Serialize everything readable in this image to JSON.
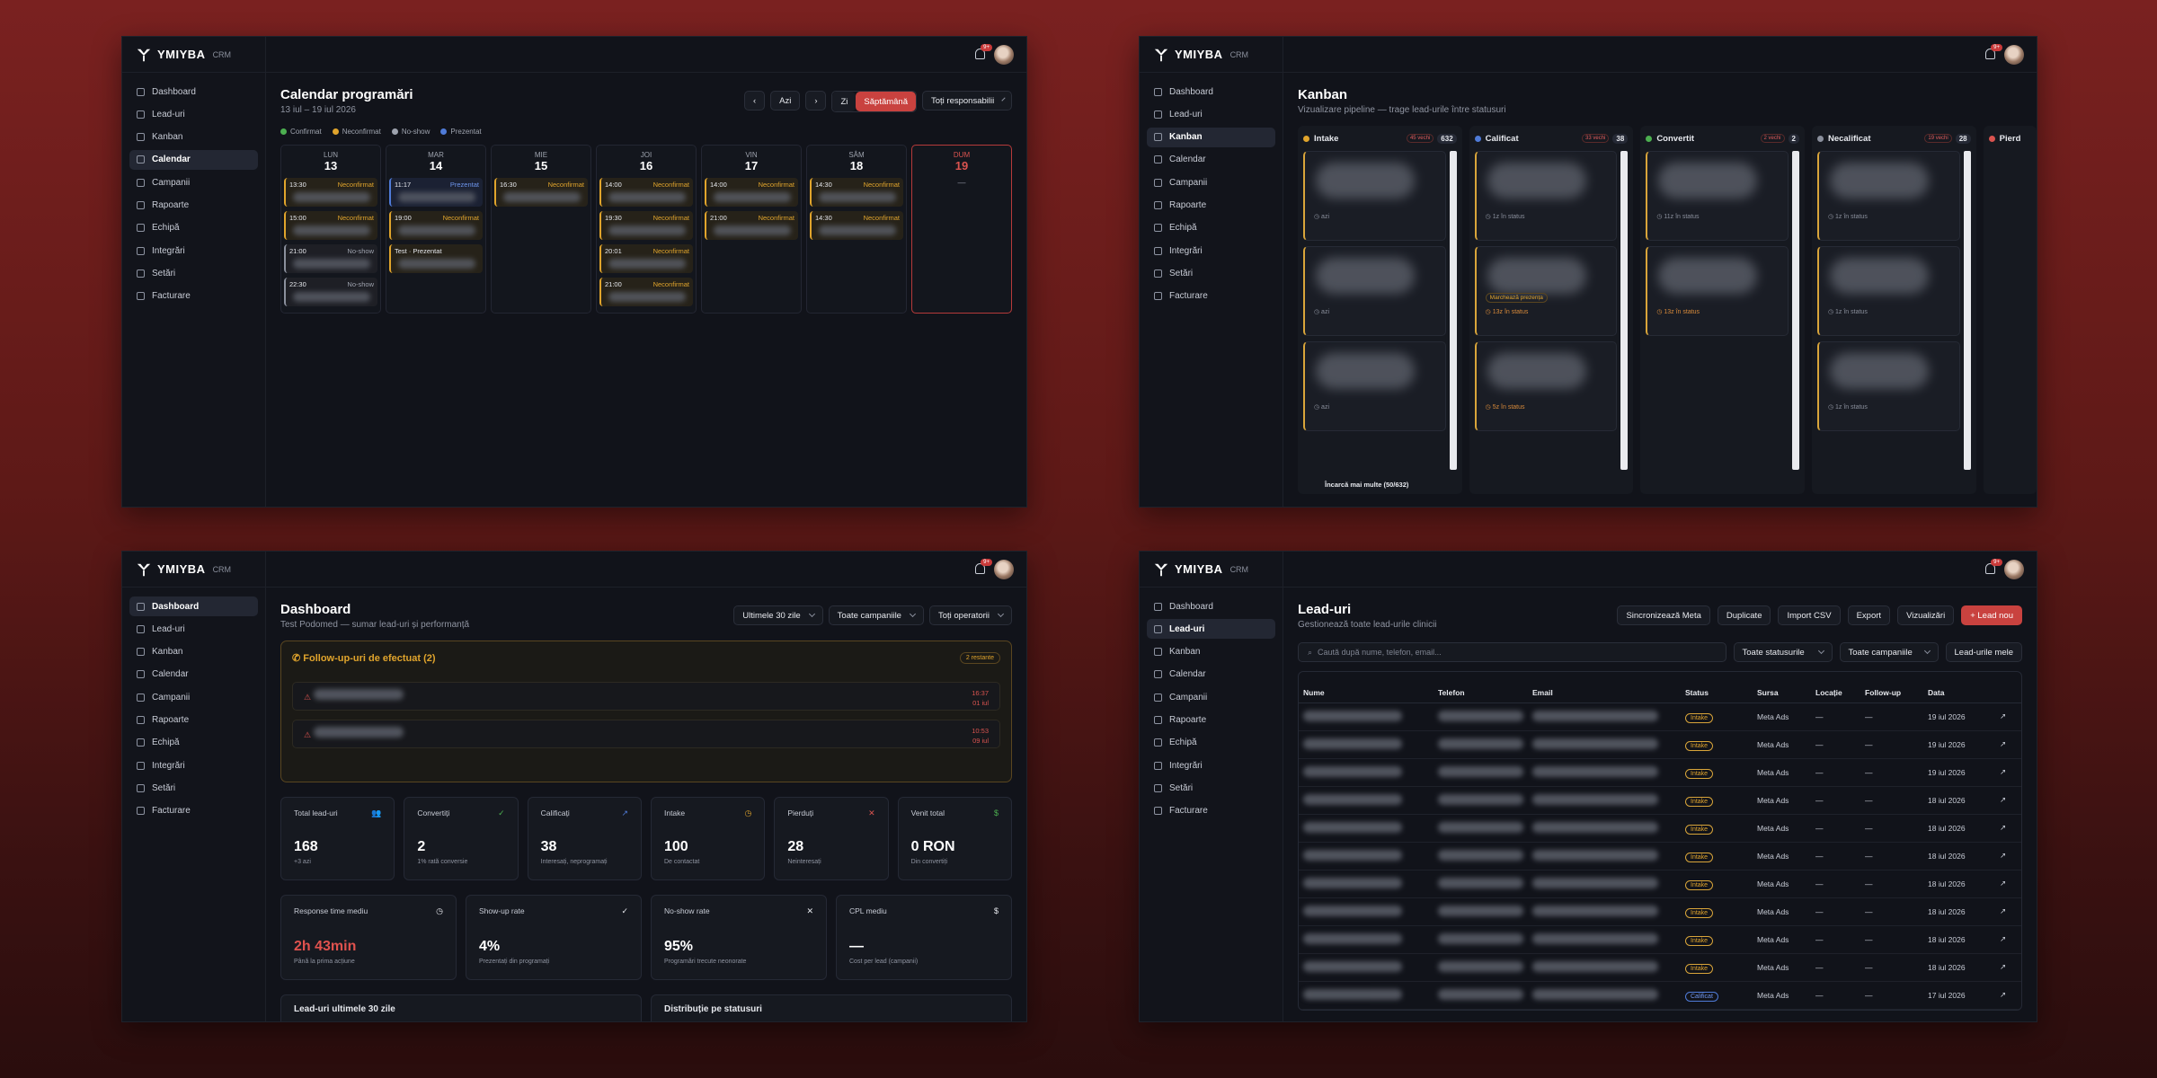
{
  "brand": {
    "name": "YMIYBA",
    "crm": "CRM",
    "notif": "9+"
  },
  "nav": [
    "Dashboard",
    "Lead-uri",
    "Kanban",
    "Calendar",
    "Campanii",
    "Rapoarte",
    "Echipă",
    "Integrări",
    "Setări",
    "Facturare"
  ],
  "calendar": {
    "title": "Calendar programări",
    "range": "13 iul – 19 iul 2026",
    "today_btn": "Azi",
    "day_btn": "Zi",
    "week_btn": "Săptămână",
    "resp": "Toți responsabilii",
    "legend": [
      {
        "label": "Confirmat",
        "color": "#4caf50"
      },
      {
        "label": "Neconfirmat",
        "color": "#e0a42c"
      },
      {
        "label": "No-show",
        "color": "#9ea3ae"
      },
      {
        "label": "Prezentat",
        "color": "#4f7bd8"
      }
    ],
    "days": [
      {
        "name": "LUN",
        "num": "13",
        "events": [
          {
            "t": "13:30",
            "s": "Neconfirmat",
            "k": "o"
          },
          {
            "t": "15:00",
            "s": "Neconfirmat",
            "k": "o"
          },
          {
            "t": "21:00",
            "s": "No-show",
            "k": "g"
          },
          {
            "t": "22:30",
            "s": "No-show",
            "k": "g"
          }
        ]
      },
      {
        "name": "MAR",
        "num": "14",
        "events": [
          {
            "t": "11:17",
            "s": "Prezentat",
            "k": "b"
          },
          {
            "t": "19:00",
            "s": "Neconfirmat",
            "k": "o"
          },
          {
            "t": "Test · Prezentat",
            "s": "",
            "k": "o"
          }
        ]
      },
      {
        "name": "MIE",
        "num": "15",
        "events": [
          {
            "t": "16:30",
            "s": "Neconfirmat",
            "k": "o"
          }
        ]
      },
      {
        "name": "JOI",
        "num": "16",
        "events": [
          {
            "t": "14:00",
            "s": "Neconfirmat",
            "k": "o"
          },
          {
            "t": "19:30",
            "s": "Neconfirmat",
            "k": "o"
          },
          {
            "t": "20:01",
            "s": "Neconfirmat",
            "k": "o"
          },
          {
            "t": "21:00",
            "s": "Neconfirmat",
            "k": "o"
          }
        ]
      },
      {
        "name": "VIN",
        "num": "17",
        "events": [
          {
            "t": "14:00",
            "s": "Neconfirmat",
            "k": "o"
          },
          {
            "t": "21:00",
            "s": "Neconfirmat",
            "k": "o"
          }
        ]
      },
      {
        "name": "SÂM",
        "num": "18",
        "events": [
          {
            "t": "14:30",
            "s": "Neconfirmat",
            "k": "o"
          },
          {
            "t": "14:30",
            "s": "Neconfirmat",
            "k": "o"
          }
        ]
      },
      {
        "name": "DUM",
        "num": "19",
        "events": [],
        "empty": "—",
        "today": true
      }
    ]
  },
  "kanban": {
    "title": "Kanban",
    "subtitle": "Vizualizare pipeline — trage lead-urile între statusuri",
    "cols": [
      {
        "name": "Intake",
        "color": "#e0a42c",
        "tag": "45 vechi",
        "count": "632",
        "cards": [
          "azi",
          "azi",
          "azi"
        ]
      },
      {
        "name": "Calificat",
        "color": "#4f7bd8",
        "tag": "33 vechi",
        "count": "38",
        "cards": [
          "1z în status",
          "13z în status",
          "5z în status"
        ],
        "badge": "Marchează prezența"
      },
      {
        "name": "Convertit",
        "color": "#4caf50",
        "tag": "2 vechi",
        "count": "2",
        "cards": [
          "11z în status",
          "13z în status"
        ]
      },
      {
        "name": "Necalificat",
        "color": "#8a8f9c",
        "tag": "19 vechi",
        "count": "28",
        "cards": [
          "1z în status",
          "1z în status",
          "1z în status"
        ]
      },
      {
        "name": "Pierd",
        "color": "#d9534f",
        "tag": "",
        "count": "",
        "cards": []
      }
    ],
    "more": "Încarcă mai multe (50/632)"
  },
  "dashboard": {
    "title": "Dashboard",
    "subtitle": "Test Podomed — sumar lead-uri și performanță",
    "filters": [
      "Ultimele 30 zile",
      "Toate campaniile",
      "Toți operatorii"
    ],
    "follow_title": "Follow-up-uri de efectuat (2)",
    "follow_badge": "2 restante",
    "follow": [
      {
        "time": "16:37",
        "date": "01 iul"
      },
      {
        "time": "10:53",
        "date": "09 iul"
      }
    ],
    "kpis": [
      {
        "label": "Total lead-uri",
        "value": "168",
        "sub": "+3 azi",
        "icon": "👥",
        "ic": "#c8ccd6"
      },
      {
        "label": "Convertiți",
        "value": "2",
        "sub": "1% rată conversie",
        "icon": "✓",
        "ic": "#4caf50"
      },
      {
        "label": "Calificați",
        "value": "38",
        "sub": "Interesați, neprogramați",
        "icon": "↗",
        "ic": "#4f7bd8"
      },
      {
        "label": "Intake",
        "value": "100",
        "sub": "De contactat",
        "icon": "◷",
        "ic": "#e0a42c"
      },
      {
        "label": "Pierduți",
        "value": "28",
        "sub": "Neinteresați",
        "icon": "✕",
        "ic": "#d9534f"
      },
      {
        "label": "Venit total",
        "value": "0 RON",
        "sub": "Din convertiți",
        "icon": "$",
        "ic": "#4caf50"
      }
    ],
    "kpis2": [
      {
        "label": "Response time mediu",
        "value": "2h 43min",
        "sub": "Până la prima acțiune",
        "icon": "◷",
        "red": true
      },
      {
        "label": "Show-up rate",
        "value": "4%",
        "sub": "Prezentați din programați",
        "icon": "✓"
      },
      {
        "label": "No-show rate",
        "value": "95%",
        "sub": "Programări trecute neonorate",
        "icon": "✕"
      },
      {
        "label": "CPL mediu",
        "value": "—",
        "sub": "Cost per lead (campanii)",
        "icon": "$"
      }
    ],
    "bottom": [
      "Lead-uri ultimele 30 zile",
      "Distribuție pe statusuri"
    ]
  },
  "leads": {
    "title": "Lead-uri",
    "subtitle": "Gestionează toate lead-urile clinicii",
    "actions": [
      "Sincronizează Meta",
      "Duplicate",
      "Import CSV",
      "Export",
      "Vizualizări"
    ],
    "new": "+ Lead nou",
    "search": "Caută după nume, telefon, email...",
    "f1": "Toate statusurile",
    "f2": "Toate campaniile",
    "mine": "Lead-urile mele",
    "cols": [
      "Nume",
      "Telefon",
      "Email",
      "Status",
      "Sursa",
      "Locație",
      "Follow-up",
      "Data"
    ],
    "rows": [
      {
        "status": "Intake",
        "src": "Meta Ads",
        "date": "19 iul 2026"
      },
      {
        "status": "Intake",
        "src": "Meta Ads",
        "date": "19 iul 2026"
      },
      {
        "status": "Intake",
        "src": "Meta Ads",
        "date": "19 iul 2026"
      },
      {
        "status": "Intake",
        "src": "Meta Ads",
        "date": "18 iul 2026"
      },
      {
        "status": "Intake",
        "src": "Meta Ads",
        "date": "18 iul 2026"
      },
      {
        "status": "Intake",
        "src": "Meta Ads",
        "date": "18 iul 2026"
      },
      {
        "status": "Intake",
        "src": "Meta Ads",
        "date": "18 iul 2026"
      },
      {
        "status": "Intake",
        "src": "Meta Ads",
        "date": "18 iul 2026"
      },
      {
        "status": "Intake",
        "src": "Meta Ads",
        "date": "18 iul 2026"
      },
      {
        "status": "Intake",
        "src": "Meta Ads",
        "date": "18 iul 2026"
      },
      {
        "status": "Calificat",
        "src": "Meta Ads",
        "date": "17 iul 2026"
      }
    ],
    "dash": "—"
  }
}
